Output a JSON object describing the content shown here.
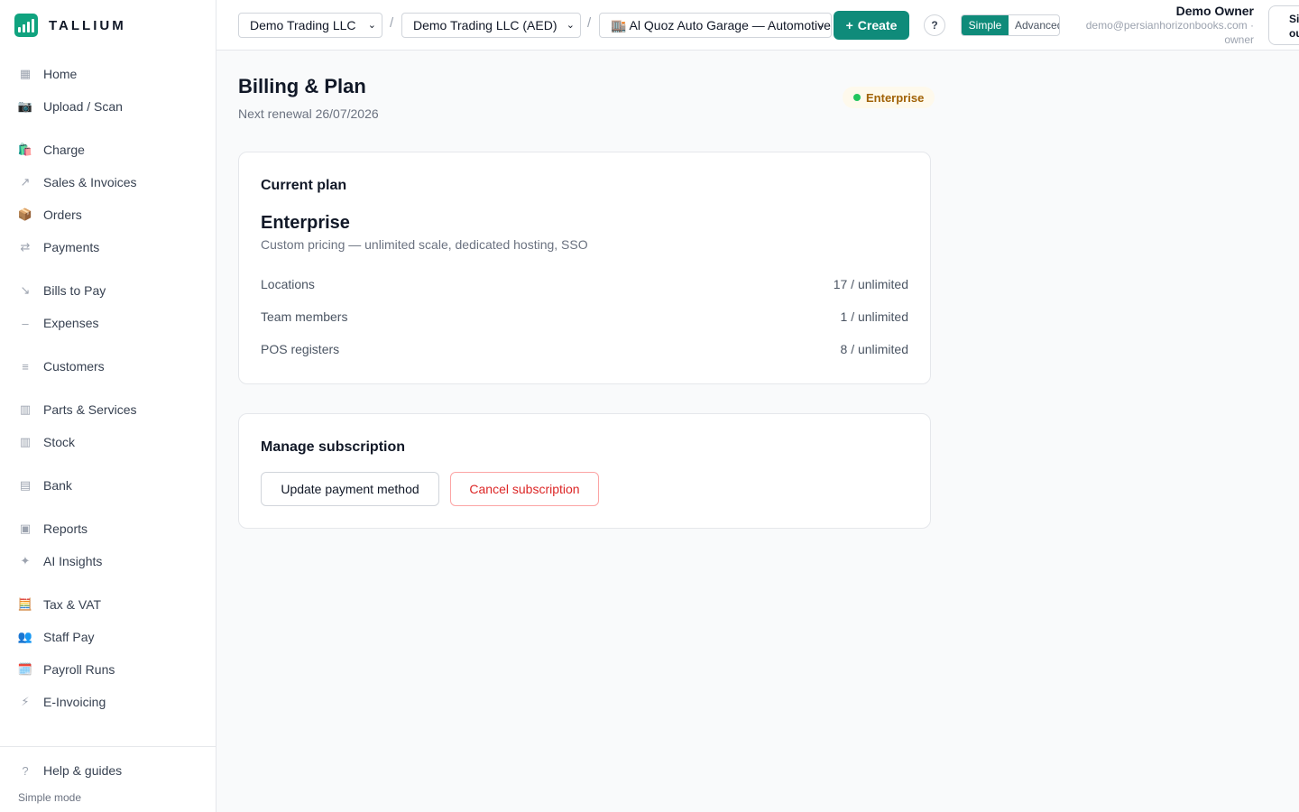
{
  "brand": {
    "name": "TALLIUM"
  },
  "sidebar": {
    "items": [
      {
        "label": "Home",
        "icon": "grid-icon",
        "glyph": "▦"
      },
      {
        "label": "Upload / Scan",
        "icon": "camera-icon",
        "glyph": "📷"
      },
      {
        "label": "Charge",
        "icon": "shopping-bag-icon",
        "glyph": "🛍️"
      },
      {
        "label": "Sales & Invoices",
        "icon": "arrow-up-right-icon",
        "glyph": "↗"
      },
      {
        "label": "Orders",
        "icon": "package-icon",
        "glyph": "📦"
      },
      {
        "label": "Payments",
        "icon": "arrows-exchange-icon",
        "glyph": "⇄"
      },
      {
        "label": "Bills to Pay",
        "icon": "arrow-down-right-icon",
        "glyph": "↘"
      },
      {
        "label": "Expenses",
        "icon": "minus-icon",
        "glyph": "–"
      },
      {
        "label": "Customers",
        "icon": "list-icon",
        "glyph": "≡"
      },
      {
        "label": "Parts & Services",
        "icon": "box-icon",
        "glyph": "▥"
      },
      {
        "label": "Stock",
        "icon": "shelves-icon",
        "glyph": "▥"
      },
      {
        "label": "Bank",
        "icon": "bank-icon",
        "glyph": "▤"
      },
      {
        "label": "Reports",
        "icon": "report-icon",
        "glyph": "▣"
      },
      {
        "label": "AI Insights",
        "icon": "sparkle-icon",
        "glyph": "✦"
      },
      {
        "label": "Tax & VAT",
        "icon": "abacus-icon",
        "glyph": "🧮"
      },
      {
        "label": "Staff Pay",
        "icon": "people-icon",
        "glyph": "👥"
      },
      {
        "label": "Payroll Runs",
        "icon": "calendar-icon",
        "glyph": "🗓️"
      },
      {
        "label": "E-Invoicing",
        "icon": "lightning-icon",
        "glyph": "⚡"
      }
    ],
    "help": {
      "label": "Help & guides",
      "glyph": "?"
    },
    "mode_label": "Simple mode"
  },
  "topbar": {
    "company_select": "Demo Trading LLC",
    "currency_select": "Demo Trading LLC (AED)",
    "location_select": "🏬 Al Quoz Auto Garage — Automotive",
    "separator": "/",
    "create_label": "Create",
    "create_glyph": "+",
    "help_glyph": "?",
    "mode_simple": "Simple",
    "mode_advanced": "Advanced",
    "user_name": "Demo Owner",
    "user_email": "demo@persianhorizonbooks.com ·",
    "user_role": "owner",
    "signout_label": "Sign out"
  },
  "page": {
    "title": "Billing & Plan",
    "subtitle": "Next renewal 26/07/2026",
    "badge": "Enterprise",
    "badge_dot_color": "#22c55e"
  },
  "current_plan": {
    "heading": "Current plan",
    "name": "Enterprise",
    "description": "Custom pricing — unlimited scale, dedicated hosting, SSO",
    "rows": [
      {
        "label": "Locations",
        "value": "17 / unlimited"
      },
      {
        "label": "Team members",
        "value": "1 / unlimited"
      },
      {
        "label": "POS registers",
        "value": "8 / unlimited"
      }
    ]
  },
  "manage": {
    "heading": "Manage subscription",
    "update_label": "Update payment method",
    "cancel_label": "Cancel subscription"
  },
  "colors": {
    "accent": "#0f8b7a",
    "danger": "#dc2626"
  }
}
